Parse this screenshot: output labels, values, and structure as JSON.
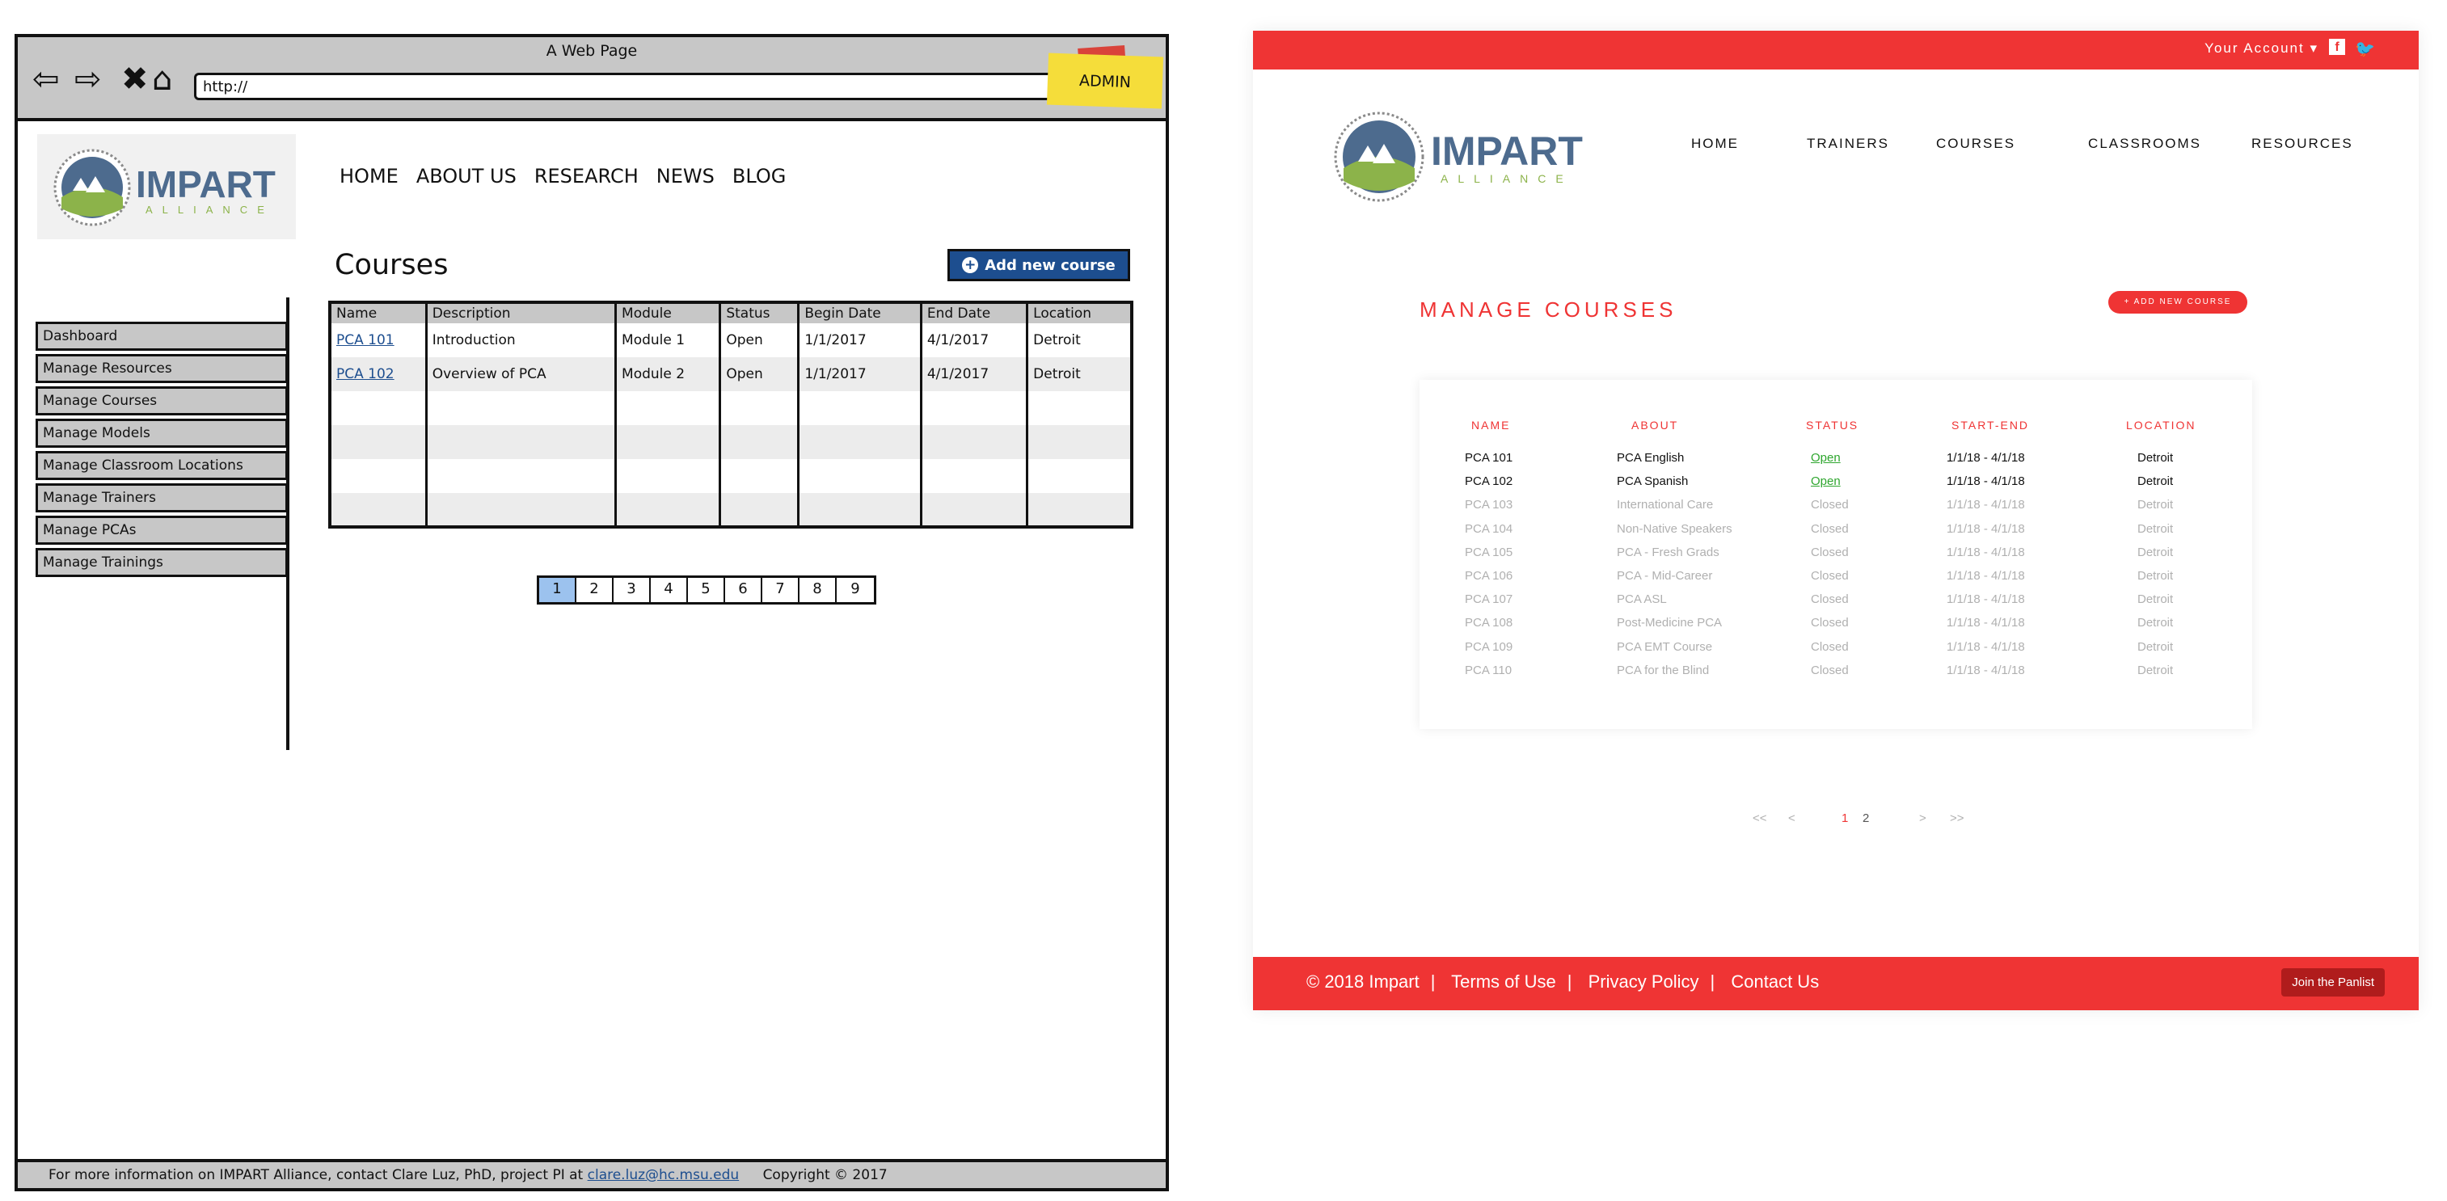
{
  "wireframe": {
    "window_title": "A Web Page",
    "url": "http://",
    "admin_note": "ADMIN",
    "nav": [
      "HOME",
      "ABOUT US",
      "RESEARCH",
      "NEWS",
      "BLOG"
    ],
    "page_title": "Courses",
    "add_button": "Add new course",
    "sidebar": [
      "Dashboard",
      "Manage Resources",
      "Manage Courses",
      "Manage Models",
      "Manage Classroom Locations",
      "Manage Trainers",
      "Manage PCAs",
      "Manage Trainings"
    ],
    "table": {
      "headers": [
        "Name",
        "Description",
        "Module",
        "Status",
        "Begin Date",
        "End Date",
        "Location"
      ],
      "rows": [
        [
          "PCA 101",
          "Introduction",
          "Module 1",
          "Open",
          "1/1/2017",
          "4/1/2017",
          "Detroit"
        ],
        [
          "PCA 102",
          "Overview of PCA",
          "Module 2",
          "Open",
          "1/1/2017",
          "4/1/2017",
          "Detroit"
        ]
      ]
    },
    "pages": [
      "1",
      "2",
      "3",
      "4",
      "5",
      "6",
      "7",
      "8",
      "9"
    ],
    "footer": {
      "text": "For more information on IMPART Alliance, contact Clare Luz, PhD, project PI at",
      "email": "clare.luz@hc.msu.edu",
      "copyright": "Copyright © 2017"
    }
  },
  "hifi": {
    "account": "Your Account ▾",
    "brand": {
      "name": "IMPART",
      "sub": "ALLIANCE"
    },
    "nav": [
      "HOME",
      "TRAINERS",
      "COURSES",
      "CLASSROOMS",
      "RESOURCES"
    ],
    "page_title": "MANAGE COURSES",
    "add_button": "+ ADD NEW COURSE",
    "columns": [
      "NAME",
      "ABOUT",
      "STATUS",
      "START-END",
      "LOCATION"
    ],
    "rows": [
      {
        "name": "PCA 101",
        "about": "PCA English",
        "status": "Open",
        "dates": "1/1/18 - 4/1/18",
        "location": "Detroit"
      },
      {
        "name": "PCA 102",
        "about": "PCA Spanish",
        "status": "Open",
        "dates": "1/1/18 - 4/1/18",
        "location": "Detroit"
      },
      {
        "name": "PCA 103",
        "about": "International Care",
        "status": "Closed",
        "dates": "1/1/18 - 4/1/18",
        "location": "Detroit"
      },
      {
        "name": "PCA 104",
        "about": "Non-Native Speakers",
        "status": "Closed",
        "dates": "1/1/18 - 4/1/18",
        "location": "Detroit"
      },
      {
        "name": "PCA 105",
        "about": "PCA - Fresh Grads",
        "status": "Closed",
        "dates": "1/1/18 - 4/1/18",
        "location": "Detroit"
      },
      {
        "name": "PCA 106",
        "about": "PCA - Mid-Career",
        "status": "Closed",
        "dates": "1/1/18 - 4/1/18",
        "location": "Detroit"
      },
      {
        "name": "PCA 107",
        "about": "PCA ASL",
        "status": "Closed",
        "dates": "1/1/18 - 4/1/18",
        "location": "Detroit"
      },
      {
        "name": "PCA 108",
        "about": "Post-Medicine PCA",
        "status": "Closed",
        "dates": "1/1/18 - 4/1/18",
        "location": "Detroit"
      },
      {
        "name": "PCA 109",
        "about": "PCA EMT Course",
        "status": "Closed",
        "dates": "1/1/18 - 4/1/18",
        "location": "Detroit"
      },
      {
        "name": "PCA 110",
        "about": "PCA for the Blind",
        "status": "Closed",
        "dates": "1/1/18 - 4/1/18",
        "location": "Detroit"
      }
    ],
    "pagination": {
      "first": "<<",
      "prev": "<",
      "pages": [
        "1",
        "2"
      ],
      "next": ">",
      "last": ">>"
    },
    "footer": {
      "copyright": "© 2018 Impart",
      "links": [
        "Terms of Use",
        "Privacy Policy",
        "Contact Us"
      ],
      "cta": "Join the Panlist"
    }
  },
  "colors": {
    "brand_red": "#ef3434",
    "wire_blue": "#1d4e8f",
    "logo_blue": "#4d6b8e",
    "logo_green": "#8cb34a"
  }
}
